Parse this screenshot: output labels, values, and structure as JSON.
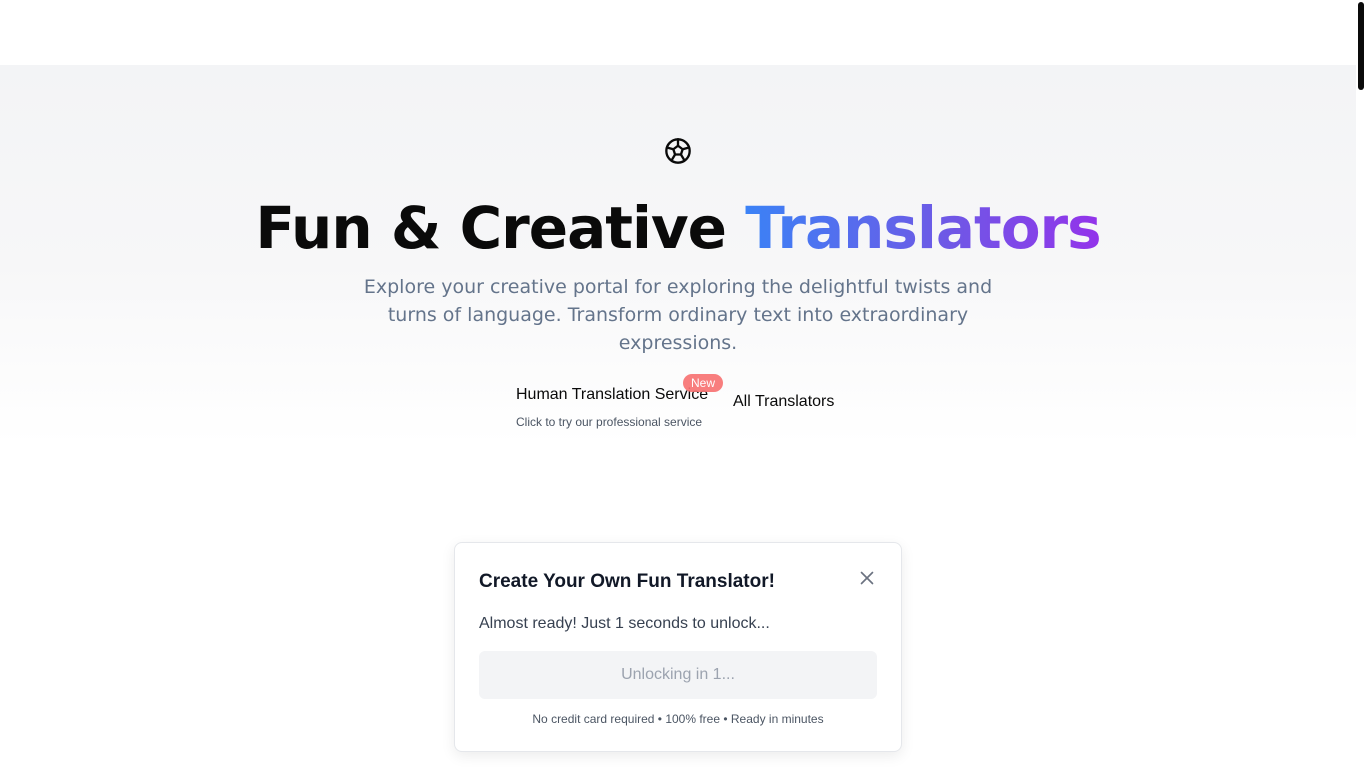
{
  "header": {},
  "hero": {
    "logo_icon": "aperture-icon",
    "title_plain": "Fun & Creative ",
    "title_highlight": "Translators",
    "subtitle": "Explore your creative portal for exploring the delightful twists and turns of language. Transform ordinary text into extraordinary expressions.",
    "human_service": {
      "title": "Human Translation Service",
      "subtitle": "Click to try our professional service",
      "badge": "New"
    },
    "all_translators_label": "All Translators"
  },
  "popup": {
    "title": "Create Your Own Fun Translator!",
    "message": "Almost ready! Just 1 seconds to unlock...",
    "button_label": "Unlocking in 1...",
    "footer": "No credit card required • 100% free • Ready in minutes",
    "close_icon": "close-icon"
  },
  "colors": {
    "accent_gradient_start": "#3b82f6",
    "accent_gradient_end": "#9333ea",
    "badge": "#f87171"
  }
}
